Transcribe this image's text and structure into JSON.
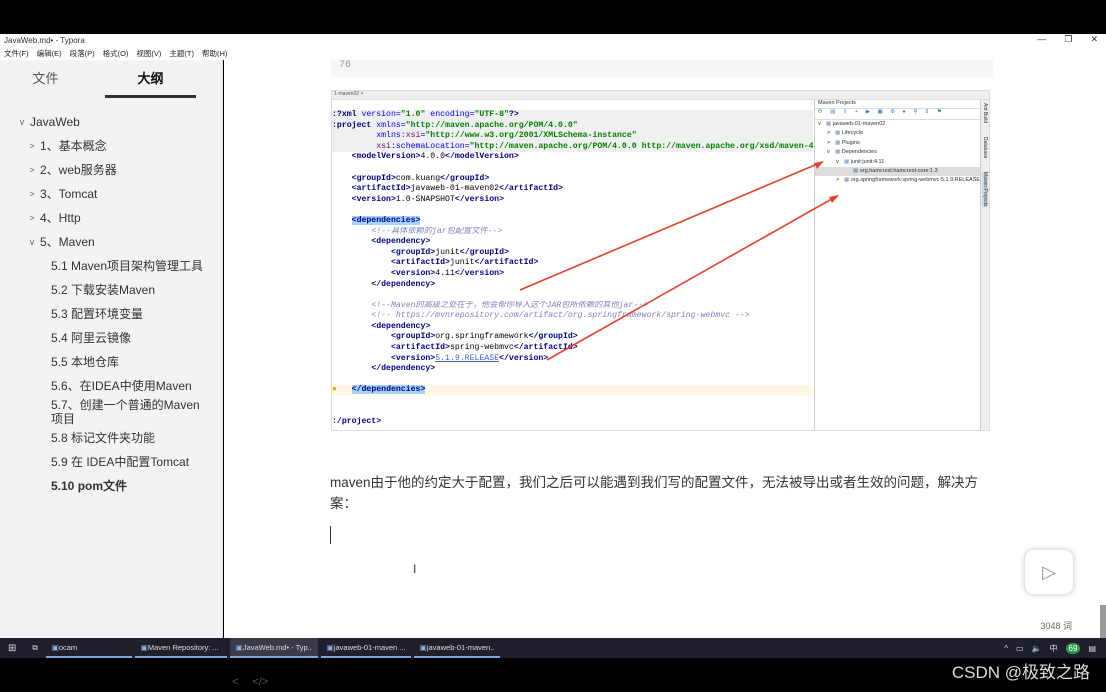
{
  "window": {
    "title": "JavaWeb.md• - Typora",
    "minimize": "—",
    "maximize": "❐",
    "close": "✕"
  },
  "menu": [
    "文件(F)",
    "编辑(E)",
    "段落(P)",
    "格式(O)",
    "视图(V)",
    "主题(T)",
    "帮助(H)"
  ],
  "sidebar": {
    "tabs": [
      "文件",
      "大纲"
    ],
    "active_tab": "大纲",
    "outline": [
      {
        "label": "JavaWeb",
        "level": 0,
        "chevron": "v"
      },
      {
        "label": "1、基本概念",
        "level": 1,
        "chevron": ">"
      },
      {
        "label": "2、web服务器",
        "level": 1,
        "chevron": ">"
      },
      {
        "label": "3、Tomcat",
        "level": 1,
        "chevron": ">"
      },
      {
        "label": "4、Http",
        "level": 1,
        "chevron": ">"
      },
      {
        "label": "5、Maven",
        "level": 1,
        "chevron": "v"
      },
      {
        "label": "5.1 Maven项目架构管理工具",
        "level": 2
      },
      {
        "label": "5.2 下载安装Maven",
        "level": 2
      },
      {
        "label": "5.3 配置环境变量",
        "level": 2
      },
      {
        "label": "5.4 阿里云镜像",
        "level": 2
      },
      {
        "label": "5.5 本地仓库",
        "level": 2
      },
      {
        "label": "5.6、在IDEA中使用Maven",
        "level": 2
      },
      {
        "label": "5.7、创建一个普通的Maven项目",
        "level": 2
      },
      {
        "label": "5.8 标记文件夹功能",
        "level": 2
      },
      {
        "label": "5.9 在 IDEA中配置Tomcat",
        "level": 2
      },
      {
        "label": "5.10 pom文件",
        "level": 2,
        "active": true
      }
    ],
    "footer": {
      "back": "<",
      "source": "</>"
    }
  },
  "main": {
    "prev_code_tail": "76",
    "screenshot": {
      "editor_tab": "1-maven02 ×",
      "maven_panel": {
        "title": "Maven Projects",
        "tree": [
          {
            "label": "javaweb-01-maven02",
            "indent": 0,
            "chevron": "v"
          },
          {
            "label": "Lifecycle",
            "indent": 1,
            "chevron": ">"
          },
          {
            "label": "Plugins",
            "indent": 1,
            "chevron": ">"
          },
          {
            "label": "Dependencies",
            "indent": 1,
            "chevron": "v"
          },
          {
            "label": "junit:junit:4.11",
            "indent": 2,
            "chevron": "v"
          },
          {
            "label": "org.hamcrest:hamcrest-core:1.3",
            "indent": 3,
            "chevron": "",
            "selected": true
          },
          {
            "label": "org.springframework:spring-webmvc:5.1.9.RELEASE",
            "indent": 2,
            "chevron": ">"
          }
        ],
        "side_tabs": [
          "Ant Build",
          "Database",
          "Maven Projects"
        ]
      }
    },
    "paragraph": "maven由于他的约定大于配置，我们之后可以能遇到我们写的配置文件，无法被导出或者生效的问题，解决方案：",
    "word_count": "3048 词"
  },
  "taskbar": {
    "items": [
      {
        "label": "ocam",
        "active": false
      },
      {
        "label": "Maven Repository: ...",
        "active": false
      },
      {
        "label": "JavaWeb.md• - Typ...",
        "active": true
      },
      {
        "label": "javaweb-01-maven ...",
        "active": false
      },
      {
        "label": "javaweb-01-maven...",
        "active": false
      }
    ],
    "tray": [
      "^",
      "中",
      "69"
    ]
  },
  "watermark": "CSDN @极致之路",
  "colors": {
    "arrow": "#e8402a",
    "selection": "#a6d2ff",
    "tag": "#000080",
    "string": "#008000"
  }
}
